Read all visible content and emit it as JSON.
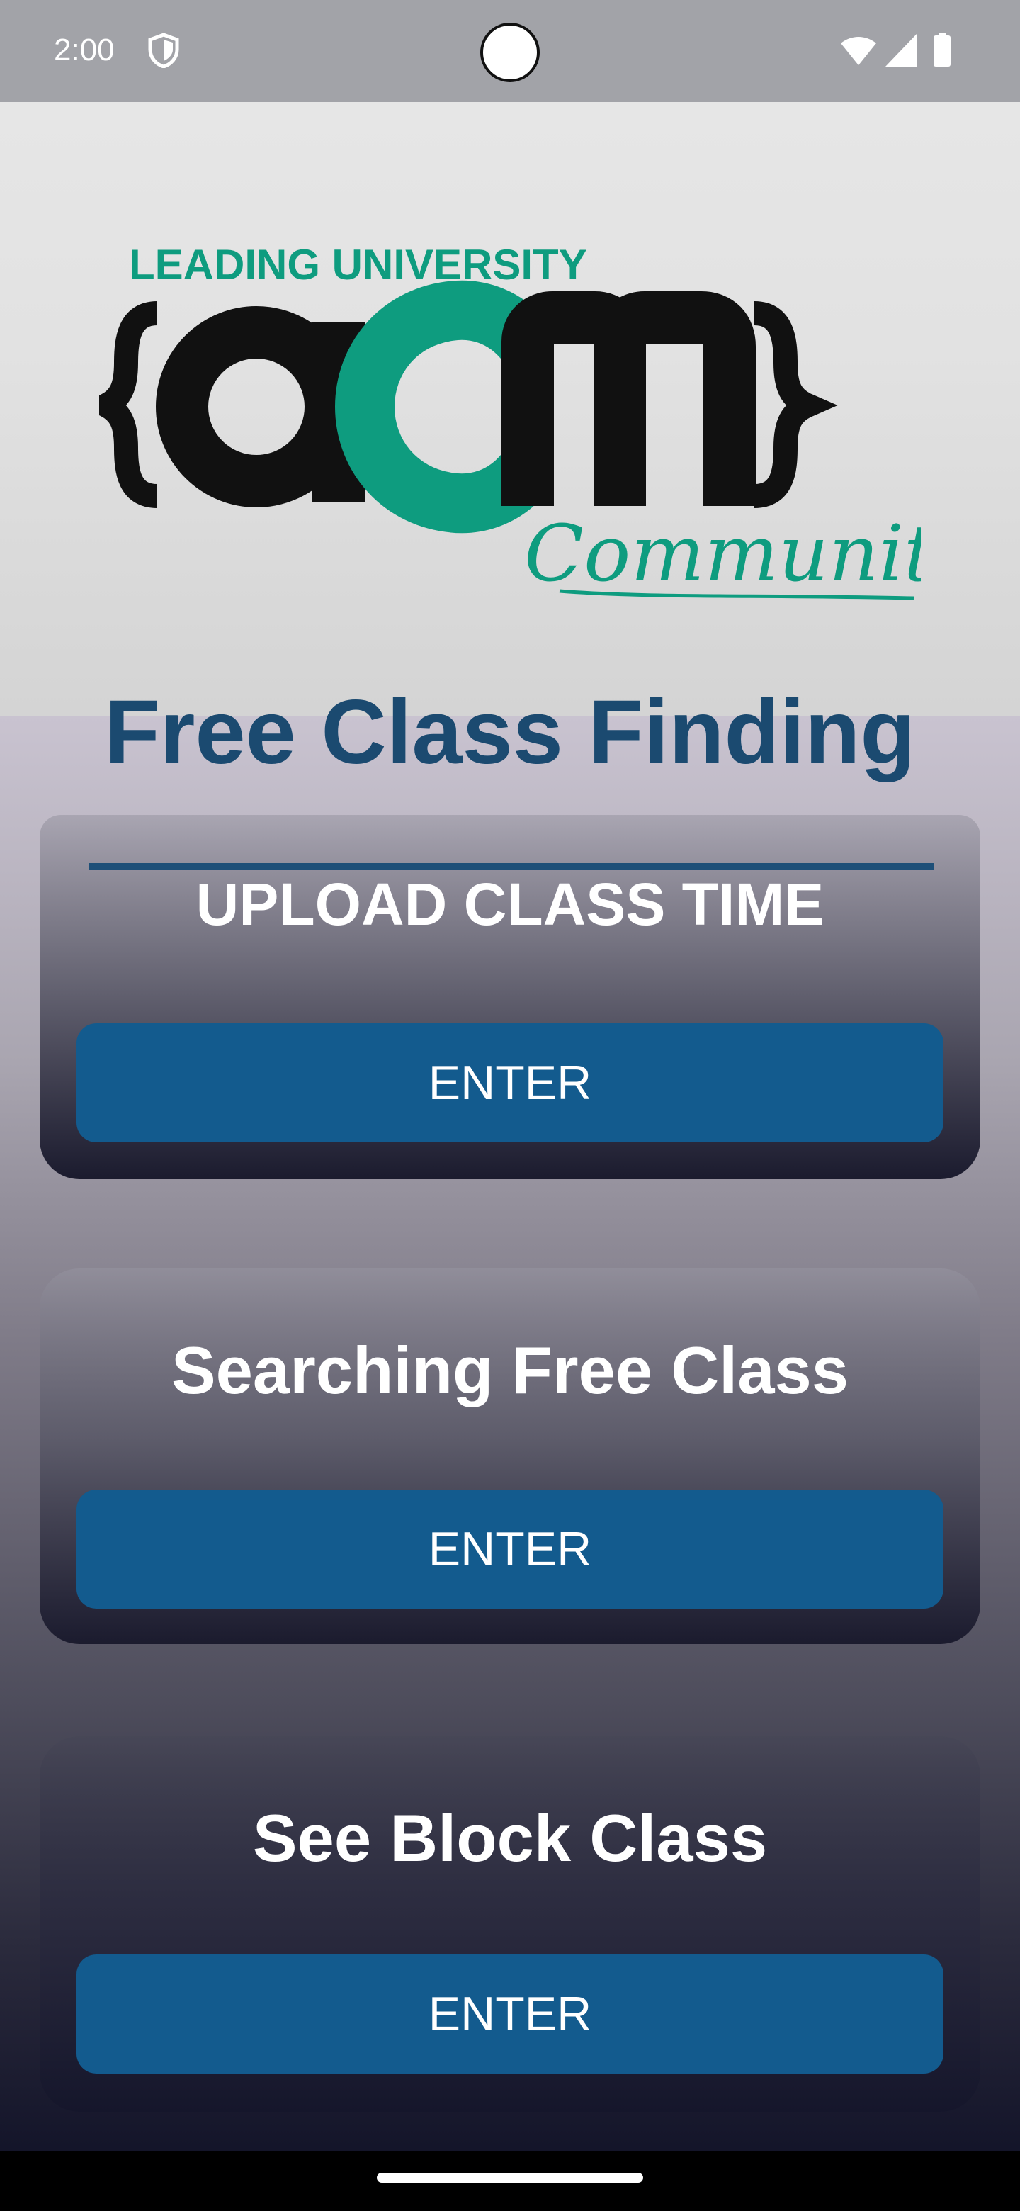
{
  "status_bar": {
    "time": "2:00",
    "icons": [
      "shield-icon",
      "wifi-icon",
      "signal-icon",
      "battery-icon"
    ]
  },
  "logo": {
    "top_text": "LEADING UNIVERSITY",
    "main_text": "acm",
    "script_text": "Community",
    "colors": {
      "dark": "#111111",
      "accent": "#0e9c7f"
    }
  },
  "page": {
    "title": "Free Class Finding"
  },
  "cards": [
    {
      "title": "UPLOAD CLASS TIME",
      "button_label": "ENTER"
    },
    {
      "title": "Searching Free Class",
      "button_label": "ENTER"
    },
    {
      "title": "See Block Class",
      "button_label": "ENTER"
    }
  ],
  "colors": {
    "title": "#1b4a70",
    "button": "#135b8e",
    "status_bar": "#a2a3a8"
  }
}
